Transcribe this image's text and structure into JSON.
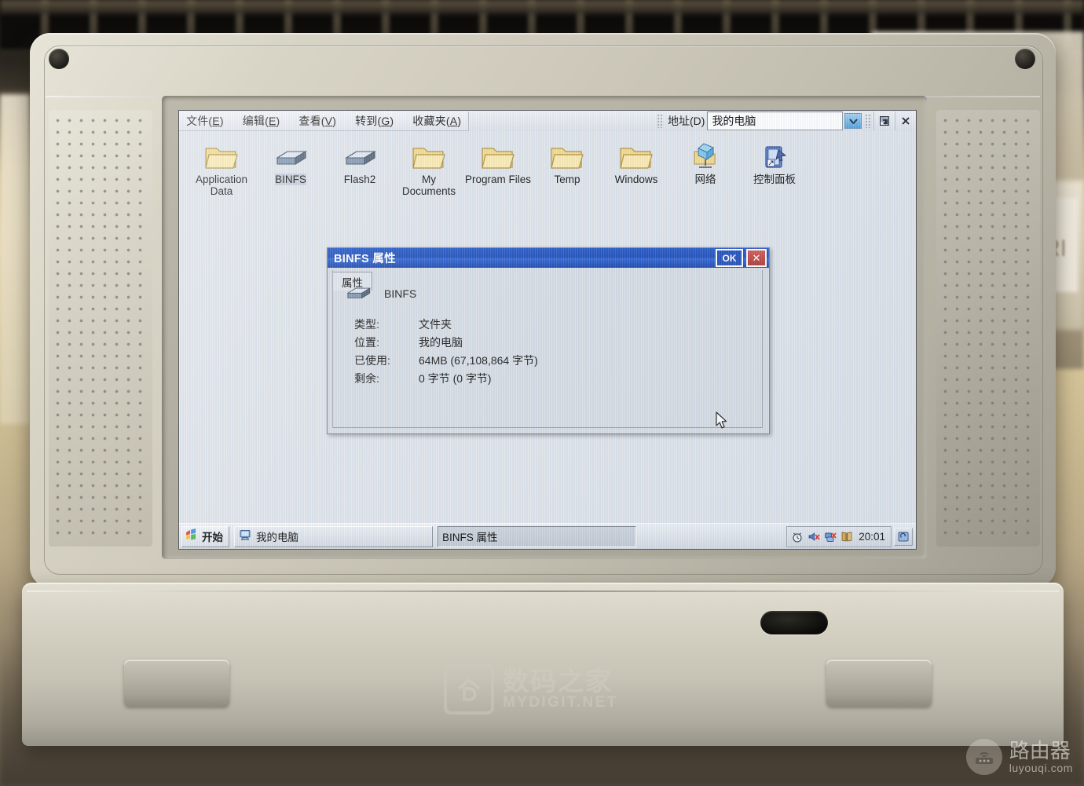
{
  "window": {
    "menu": [
      {
        "label": "文件(",
        "accel": "E",
        "tail": ")"
      },
      {
        "label": "编辑(",
        "accel": "E",
        "tail": ")"
      },
      {
        "label": "查看(",
        "accel": "V",
        "tail": ")"
      },
      {
        "label": "转到(",
        "accel": "G",
        "tail": ")"
      },
      {
        "label": "收藏夹(",
        "accel": "A",
        "tail": ")"
      }
    ],
    "address_label": "地址(D)",
    "address_value": "我的电脑",
    "dropdown_icon": "chevron-down-icon",
    "restore_icon": "restore-window-icon",
    "close_icon": "close-icon"
  },
  "icons": [
    {
      "label": "Application Data",
      "icon": "folder-icon",
      "selected": false
    },
    {
      "label": "BINFS",
      "icon": "drive-icon",
      "selected": true
    },
    {
      "label": "Flash2",
      "icon": "drive-icon",
      "selected": false
    },
    {
      "label": "My Documents",
      "icon": "folder-icon",
      "selected": false
    },
    {
      "label": "Program Files",
      "icon": "folder-icon",
      "selected": false
    },
    {
      "label": "Temp",
      "icon": "folder-icon",
      "selected": false
    },
    {
      "label": "Windows",
      "icon": "folder-icon",
      "selected": false
    },
    {
      "label": "网络",
      "icon": "network-icon",
      "selected": false
    },
    {
      "label": "控制面板",
      "icon": "control-panel-icon",
      "selected": false
    }
  ],
  "dialog": {
    "title": "BINFS 属性",
    "ok_label": "OK",
    "close_label": "✕",
    "tab_label": "属性",
    "item_icon": "drive-icon",
    "item_name": "BINFS",
    "rows": [
      {
        "key": "类型:",
        "value": "文件夹"
      },
      {
        "key": "位置:",
        "value": "我的电脑"
      },
      {
        "key": "已使用:",
        "value": "64MB (67,108,864 字节)"
      },
      {
        "key": "剩余:",
        "value": "0 字节 (0 字节)"
      }
    ]
  },
  "taskbar": {
    "start_label": "开始",
    "start_icon": "windows-flag-icon",
    "buttons": [
      {
        "label": "我的电脑",
        "icon": "my-computer-icon",
        "active": false
      },
      {
        "label": "BINFS 属性",
        "icon": "none",
        "active": true
      }
    ],
    "tray": [
      {
        "icon": "alarm-clock-icon"
      },
      {
        "icon": "volume-muted-icon"
      },
      {
        "icon": "network-disconnected-icon"
      },
      {
        "icon": "tasks-icon"
      }
    ],
    "time": "20:01",
    "show_desktop_icon": "show-desktop-icon"
  },
  "watermarks": {
    "primary_cn": "数码之家",
    "primary_en": "MYDIGIT.NET",
    "primary_logo": "house-d-logo-icon",
    "secondary_cn": "路由器",
    "secondary_en": "luyouqi.com",
    "secondary_logo": "router-icon"
  },
  "colors": {
    "titlebar_blue": "#1948b4",
    "accent_red": "#b5362f",
    "screen_bg": "#dfe4ea",
    "chassis": "#d5d1c3"
  }
}
